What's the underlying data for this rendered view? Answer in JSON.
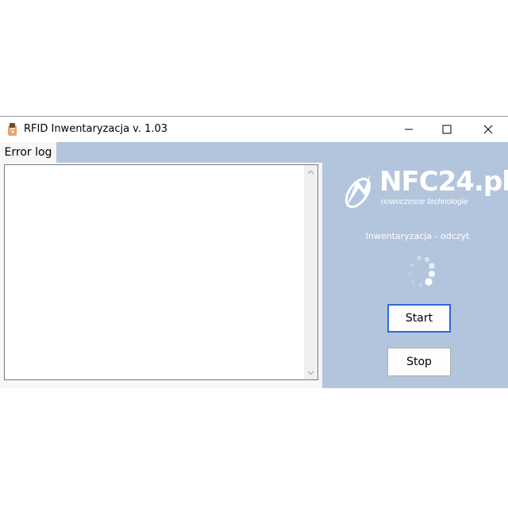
{
  "window": {
    "title": "RFID Inwentaryzacja v. 1.03",
    "app_icon": "rfid-app-icon",
    "controls": {
      "minimize": "minimize-icon",
      "maximize": "maximize-icon",
      "close": "close-icon"
    }
  },
  "tabs": [
    {
      "label": "Error log",
      "active": true
    }
  ],
  "error_log": {
    "value": ""
  },
  "brand": {
    "logo_text": "NFC24.pl",
    "tagline": "nowoczesne technologie"
  },
  "status": {
    "text": "Inwentaryzacja - odczyt"
  },
  "buttons": {
    "start_label": "Start",
    "stop_label": "Stop"
  },
  "colors": {
    "panel_bg": "#b3c5dd",
    "focus_border": "#2a6ad6",
    "text_white": "#ffffff"
  }
}
